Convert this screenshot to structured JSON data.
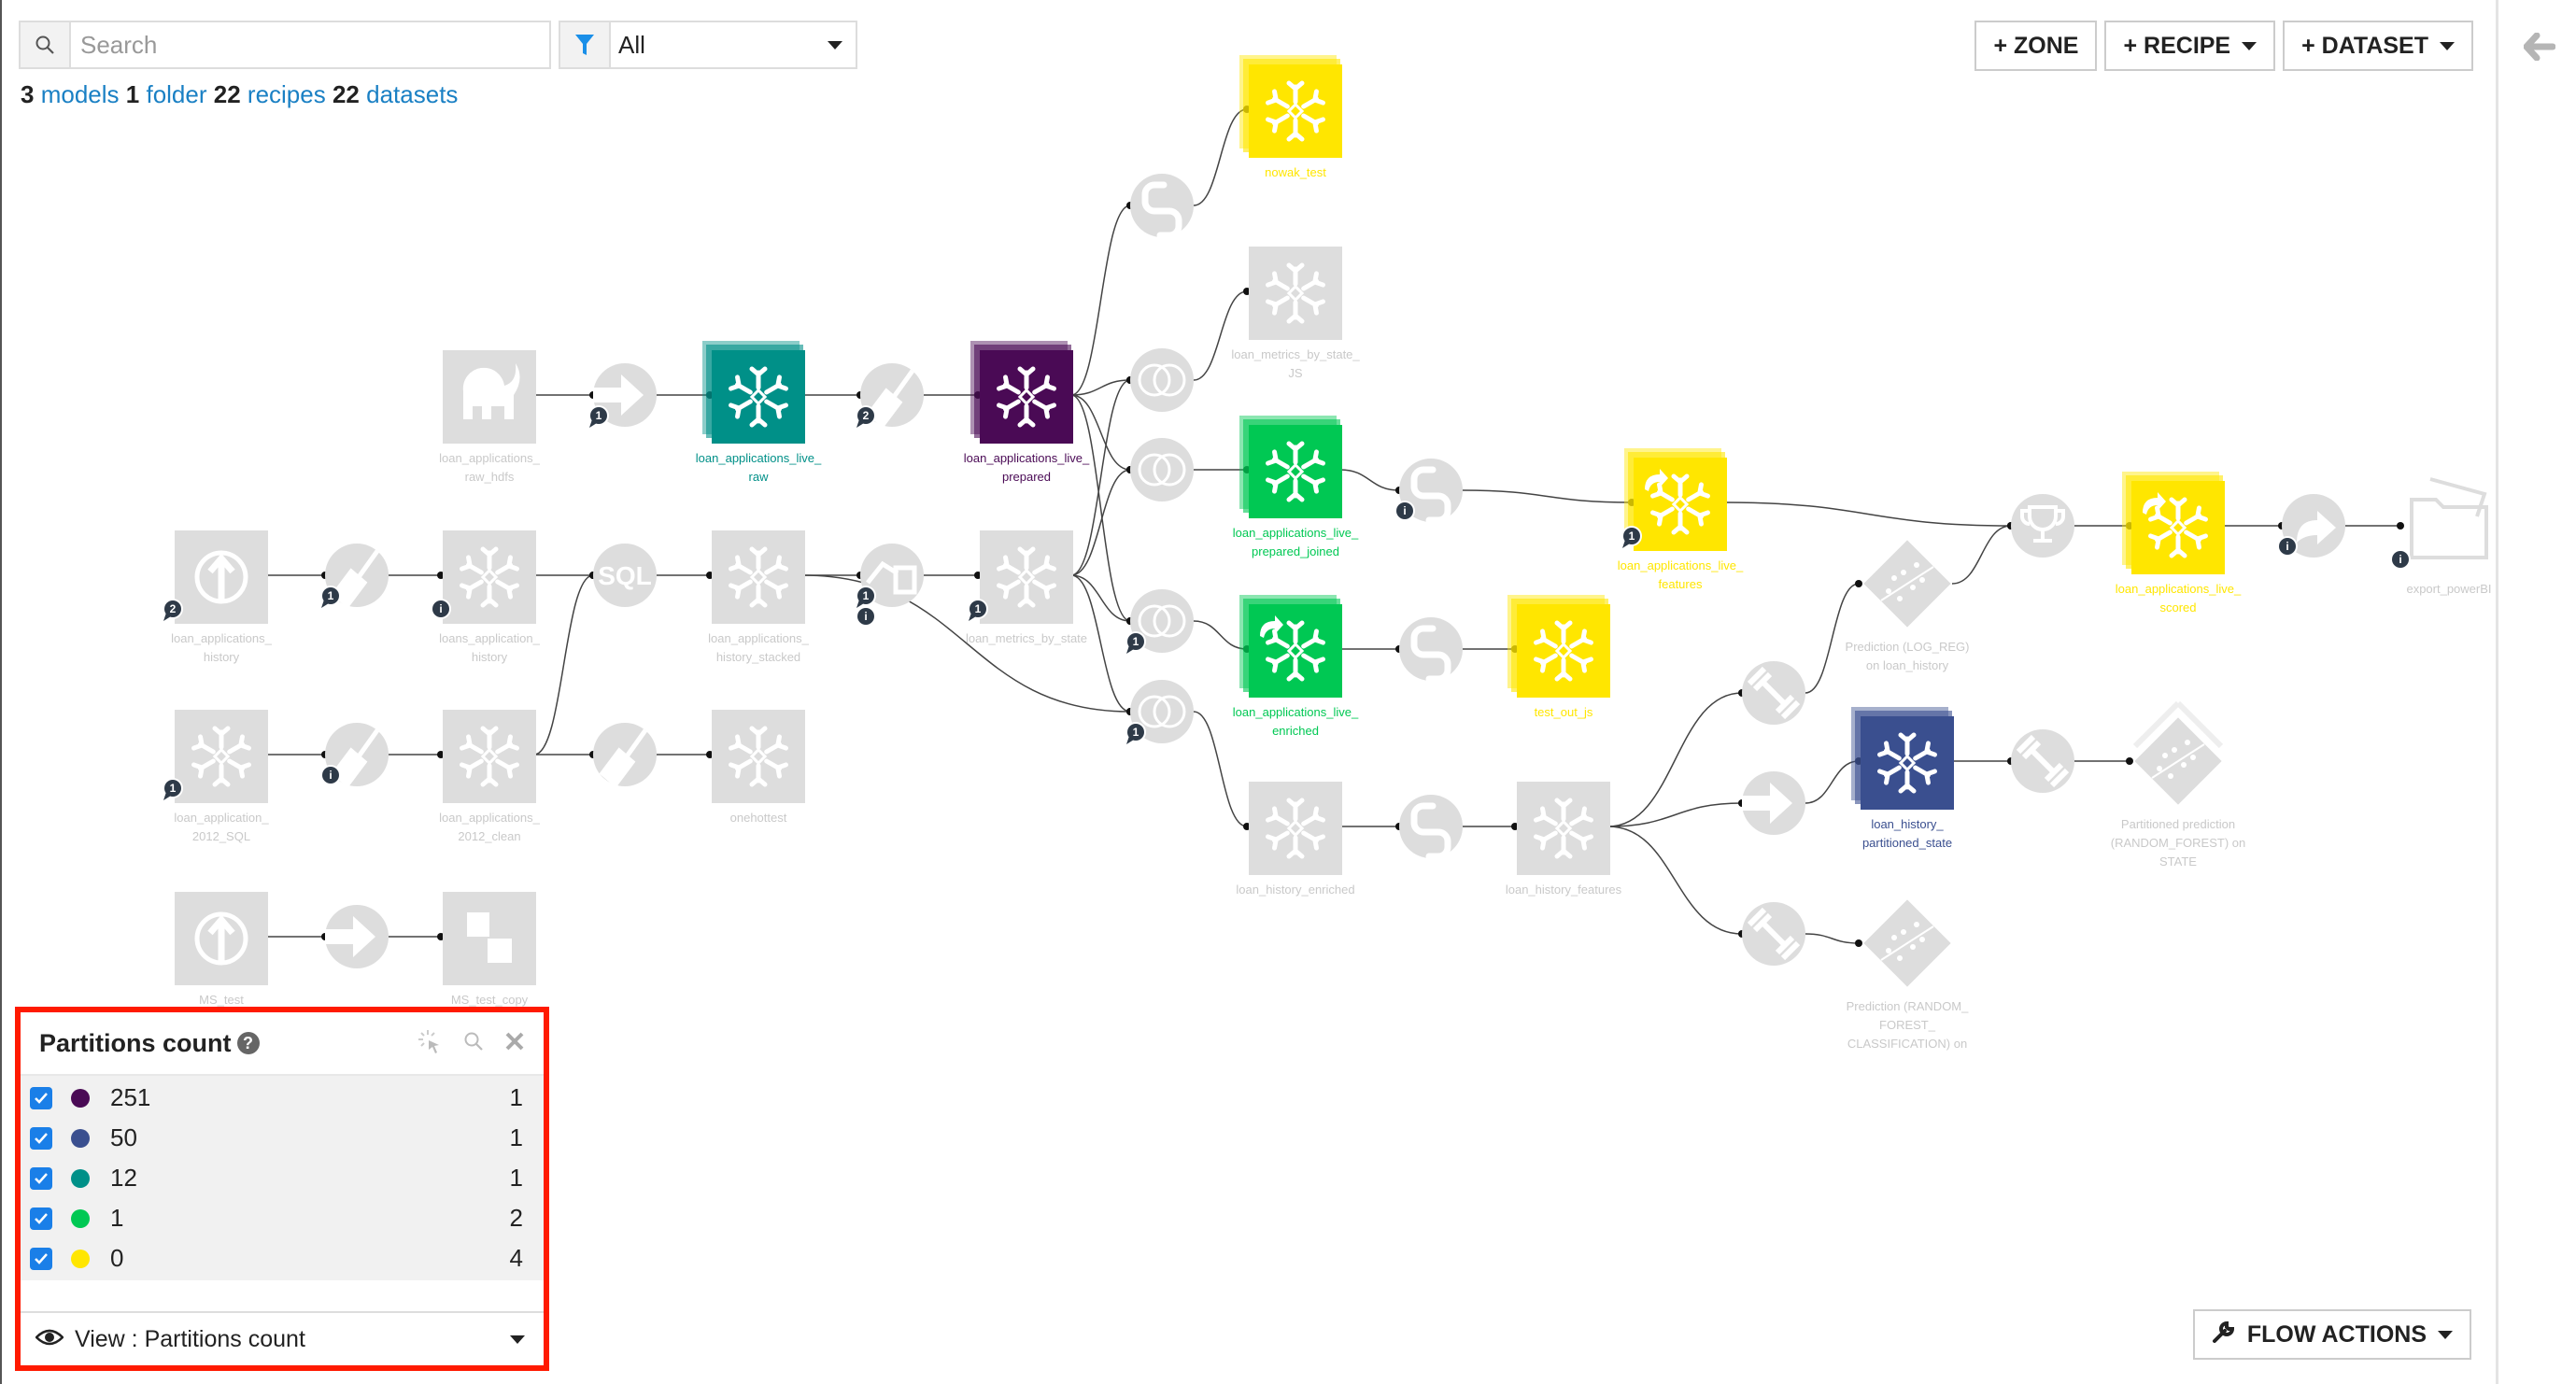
{
  "toolbar": {
    "search_placeholder": "Search",
    "search_value": "",
    "filter_value": "All",
    "counts": {
      "models_n": "3",
      "models_label": "models",
      "folder_n": "1",
      "folder_label": "folder",
      "recipes_n": "22",
      "recipes_label": "recipes",
      "datasets_n": "22",
      "datasets_label": "datasets"
    }
  },
  "top_buttons": {
    "zone": "+ ZONE",
    "recipe": "+ RECIPE",
    "dataset": "+ DATASET"
  },
  "flow_actions": "FLOW ACTIONS",
  "colors": {
    "grey_node": "#dddddd",
    "p251": "#4a0a55",
    "p50": "#3a4f8f",
    "p12": "#009088",
    "p1": "#00c853",
    "p0": "#ffe600",
    "badge": "#2e3a48",
    "accent": "#1a80c4",
    "highlight_border": "#ff1a00"
  },
  "legend": {
    "title": "Partitions count",
    "items": [
      {
        "value": "251",
        "count": "1",
        "color": "#4a0a55",
        "checked": true
      },
      {
        "value": "50",
        "count": "1",
        "color": "#3a4f8f",
        "checked": true
      },
      {
        "value": "12",
        "count": "1",
        "color": "#009088",
        "checked": true
      },
      {
        "value": "1",
        "count": "2",
        "color": "#00c853",
        "checked": true
      },
      {
        "value": "0",
        "count": "4",
        "color": "#ffe600",
        "checked": true
      }
    ],
    "view_label": "View : Partitions count"
  },
  "flow": {
    "datasets": [
      {
        "id": "raw_hdfs",
        "label": [
          "loan_applications_",
          "raw_hdfs"
        ],
        "icon": "hadoop-elephant",
        "color": "grey",
        "stack": false
      },
      {
        "id": "live_raw",
        "label": [
          "loan_applications_live_",
          "raw"
        ],
        "icon": "snowflake",
        "color": "p12",
        "stack": true
      },
      {
        "id": "live_prepared",
        "label": [
          "loan_applications_live_",
          "prepared"
        ],
        "icon": "snowflake",
        "color": "p251",
        "stack": true
      },
      {
        "id": "nowak_test",
        "label": [
          "nowak_test"
        ],
        "icon": "snowflake",
        "color": "p0",
        "stack": true
      },
      {
        "id": "metrics_js",
        "label": [
          "loan_metrics_by_state_",
          "JS"
        ],
        "icon": "snowflake",
        "color": "grey",
        "stack": false
      },
      {
        "id": "prepared_joined",
        "label": [
          "loan_applications_live_",
          "prepared_joined"
        ],
        "icon": "snowflake",
        "color": "p1",
        "stack": true
      },
      {
        "id": "enriched",
        "label": [
          "loan_applications_live_",
          "enriched"
        ],
        "icon": "snowflake",
        "color": "p1",
        "stack": true,
        "shared": true
      },
      {
        "id": "test_out_js",
        "label": [
          "test_out_js"
        ],
        "icon": "snowflake",
        "color": "p0",
        "stack": true
      },
      {
        "id": "live_features",
        "label": [
          "loan_applications_live_",
          "features"
        ],
        "icon": "snowflake",
        "color": "p0",
        "stack": true,
        "shared": true
      },
      {
        "id": "live_scored",
        "label": [
          "loan_applications_live_",
          "scored"
        ],
        "icon": "snowflake",
        "color": "p0",
        "stack": true,
        "shared": true
      },
      {
        "id": "export_powerbi",
        "label": [
          "export_powerBI"
        ],
        "icon": "folder",
        "color": "folder",
        "stack": false
      },
      {
        "id": "app_history",
        "label": [
          "loan_applications_",
          "history"
        ],
        "icon": "upload",
        "color": "grey",
        "stack": false
      },
      {
        "id": "loans_app_history",
        "label": [
          "loans_application_",
          "history"
        ],
        "icon": "snowflake",
        "color": "grey",
        "stack": false
      },
      {
        "id": "history_stacked",
        "label": [
          "loan_applications_",
          "history_stacked"
        ],
        "icon": "snowflake",
        "color": "grey",
        "stack": false
      },
      {
        "id": "metrics_by_state",
        "label": [
          "loan_metrics_by_state"
        ],
        "icon": "snowflake",
        "color": "grey",
        "stack": false
      },
      {
        "id": "app_2012_sql",
        "label": [
          "loan_application_",
          "2012_SQL"
        ],
        "icon": "snowflake",
        "color": "grey",
        "stack": false
      },
      {
        "id": "app_2012_clean",
        "label": [
          "loan_applications_",
          "2012_clean"
        ],
        "icon": "snowflake",
        "color": "grey",
        "stack": false
      },
      {
        "id": "onehottest",
        "label": [
          "onehottest"
        ],
        "icon": "snowflake",
        "color": "grey",
        "stack": false
      },
      {
        "id": "ms_test",
        "label": [
          "MS_test"
        ],
        "icon": "upload",
        "color": "grey",
        "stack": false
      },
      {
        "id": "ms_test_copy",
        "label": [
          "MS_test_copy"
        ],
        "icon": "boxes",
        "color": "grey",
        "stack": false
      },
      {
        "id": "history_enriched",
        "label": [
          "loan_history_enriched"
        ],
        "icon": "snowflake",
        "color": "grey",
        "stack": false
      },
      {
        "id": "history_features",
        "label": [
          "loan_history_features"
        ],
        "icon": "snowflake",
        "color": "grey",
        "stack": false
      },
      {
        "id": "partitioned_state",
        "label": [
          "loan_history_",
          "partitioned_state"
        ],
        "icon": "snowflake",
        "color": "p50",
        "stack": true
      }
    ],
    "models": [
      {
        "id": "pred_logreg",
        "label": [
          "Prediction (LOG_REG)",
          "on loan_history"
        ]
      },
      {
        "id": "pred_rf_state",
        "label": [
          "Partitioned prediction",
          "(RANDOM_FOREST) on",
          "STATE"
        ],
        "stack": true
      },
      {
        "id": "pred_rf_class",
        "label": [
          "Prediction (RANDOM_",
          "FOREST_",
          "CLASSIFICATION) on"
        ]
      }
    ],
    "recipes": [
      {
        "id": "r_sync1",
        "icon": "arrow-right"
      },
      {
        "id": "r_prep1",
        "icon": "broom"
      },
      {
        "id": "r_py_nowak",
        "icon": "python"
      },
      {
        "id": "r_join_js",
        "icon": "join"
      },
      {
        "id": "r_join_pj",
        "icon": "join"
      },
      {
        "id": "r_join_en",
        "icon": "join"
      },
      {
        "id": "r_join_he",
        "icon": "join"
      },
      {
        "id": "r_py_feat",
        "icon": "python"
      },
      {
        "id": "r_py_test",
        "icon": "python"
      },
      {
        "id": "r_prep_hist",
        "icon": "broom"
      },
      {
        "id": "r_sql",
        "icon": "sql"
      },
      {
        "id": "r_group",
        "icon": "group"
      },
      {
        "id": "r_prep_2012",
        "icon": "broom"
      },
      {
        "id": "r_prep_onehot",
        "icon": "broom"
      },
      {
        "id": "r_sync_ms",
        "icon": "arrow-right"
      },
      {
        "id": "r_py_hist",
        "icon": "python"
      },
      {
        "id": "r_train_logreg",
        "icon": "dumbbell"
      },
      {
        "id": "r_sync_part",
        "icon": "arrow-right"
      },
      {
        "id": "r_train_rf_class",
        "icon": "dumbbell"
      },
      {
        "id": "r_train_rf_state",
        "icon": "dumbbell"
      },
      {
        "id": "r_score",
        "icon": "trophy"
      },
      {
        "id": "r_export",
        "icon": "export"
      }
    ],
    "badges": [
      {
        "at": "r_sync1",
        "type": "comment",
        "text": "1"
      },
      {
        "at": "r_prep1",
        "type": "comment",
        "text": "2"
      },
      {
        "at": "r_prep_hist",
        "type": "comment",
        "text": "1"
      },
      {
        "at": "loans_app_history",
        "type": "info",
        "text": "i"
      },
      {
        "at": "app_history",
        "type": "comment",
        "text": "2"
      },
      {
        "at": "r_group",
        "type": "comment",
        "text": "1"
      },
      {
        "at": "r_group",
        "type": "info",
        "text": "i"
      },
      {
        "at": "metrics_by_state",
        "type": "comment",
        "text": "1"
      },
      {
        "at": "r_join_en",
        "type": "comment",
        "text": "1"
      },
      {
        "at": "r_join_he",
        "type": "comment",
        "text": "1"
      },
      {
        "at": "r_py_feat",
        "type": "info",
        "text": "i"
      },
      {
        "at": "live_features",
        "type": "comment",
        "text": "1"
      },
      {
        "at": "app_2012_sql",
        "type": "comment",
        "text": "1"
      },
      {
        "at": "r_prep_2012",
        "type": "info",
        "text": "i"
      },
      {
        "at": "r_export",
        "type": "info",
        "text": "i"
      },
      {
        "at": "export_powerbi",
        "type": "info",
        "text": "i"
      }
    ]
  }
}
